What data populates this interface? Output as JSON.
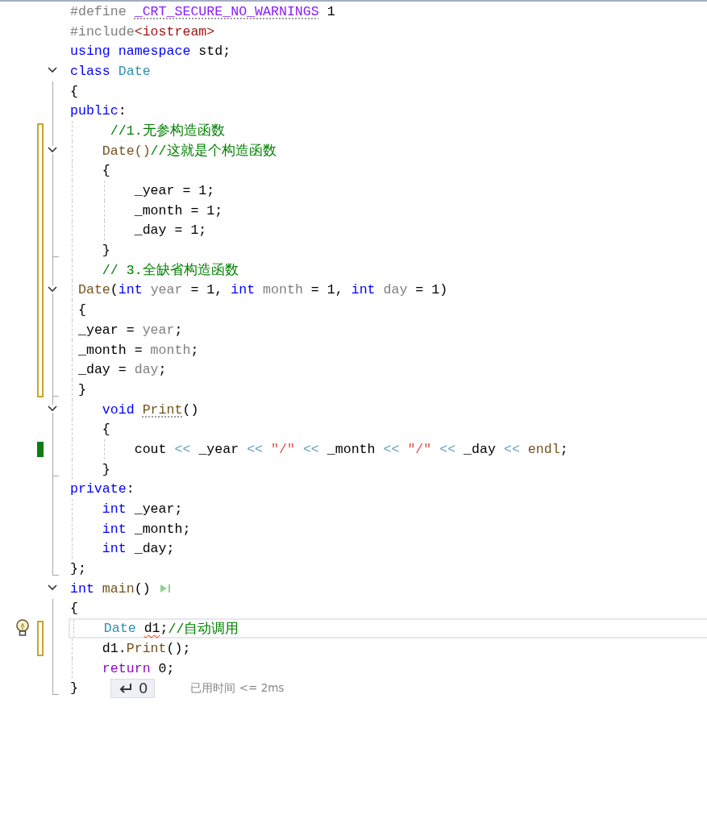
{
  "lines": [
    {
      "tokens": [
        {
          "text": "#define",
          "kind": "preprocessor"
        },
        {
          "text": " _CRT_SECURE_NO_WARNINGS",
          "kind": "macro",
          "hint": true
        },
        {
          "text": " 1",
          "kind": "plain"
        }
      ],
      "modified": false,
      "saved": false,
      "current": false,
      "lightbulb": false
    },
    {
      "tokens": [
        {
          "text": "#include",
          "kind": "preprocessor"
        },
        {
          "text": "<iostream>",
          "kind": "include_path"
        }
      ],
      "modified": false,
      "saved": false,
      "current": false,
      "lightbulb": false
    },
    {
      "tokens": [
        {
          "text": "using namespace",
          "kind": "keyword"
        },
        {
          "text": " std;",
          "kind": "plain"
        }
      ],
      "modified": false,
      "saved": false,
      "current": false,
      "lightbulb": false
    },
    {
      "tokens": [
        {
          "text": "class",
          "kind": "keyword"
        },
        {
          "text": " Date",
          "kind": "type"
        }
      ],
      "modified": false,
      "saved": false,
      "current": false,
      "lightbulb": false,
      "expanded": true,
      "children": [
        {
          "tokens": [
            {
              "text": "{",
              "kind": "plain"
            }
          ],
          "modified": false,
          "saved": false,
          "current": false,
          "lightbulb": false
        },
        {
          "tokens": [
            {
              "text": "public",
              "kind": "keyword"
            },
            {
              "text": ":",
              "kind": "plain"
            }
          ],
          "modified": false,
          "saved": false,
          "current": false,
          "lightbulb": false
        },
        {
          "tokens": [
            {
              "text": "     //1.无参构造函数",
              "kind": "comment"
            }
          ],
          "modified": true,
          "saved": false,
          "current": false,
          "lightbulb": false
        },
        {
          "tokens": [
            {
              "text": "    Date()",
              "kind": "function"
            },
            {
              "text": "//这就是个构造函数",
              "kind": "comment"
            }
          ],
          "modified": true,
          "saved": false,
          "current": false,
          "lightbulb": false,
          "expanded": true,
          "children": [
            {
              "tokens": [
                {
                  "text": "    {",
                  "kind": "plain"
                }
              ],
              "modified": true,
              "saved": false,
              "current": false,
              "lightbulb": false
            },
            {
              "tokens": [
                {
                  "text": "        _year = 1;",
                  "kind": "plain"
                }
              ],
              "modified": true,
              "saved": false,
              "current": false,
              "lightbulb": false
            },
            {
              "tokens": [
                {
                  "text": "        _month = 1;",
                  "kind": "plain"
                }
              ],
              "modified": true,
              "saved": false,
              "current": false,
              "lightbulb": false
            },
            {
              "tokens": [
                {
                  "text": "        _day = 1;",
                  "kind": "plain"
                }
              ],
              "modified": true,
              "saved": false,
              "current": false,
              "lightbulb": false
            },
            {
              "tokens": [
                {
                  "text": "    }",
                  "kind": "plain"
                }
              ],
              "modified": true,
              "saved": false,
              "current": false,
              "lightbulb": false
            }
          ]
        },
        {
          "tokens": [
            {
              "text": "    // 3.全缺省构造函数",
              "kind": "comment"
            }
          ],
          "modified": true,
          "saved": false,
          "current": false,
          "lightbulb": false
        },
        {
          "tokens": [
            {
              "text": " Date",
              "kind": "function"
            },
            {
              "text": "(",
              "kind": "plain"
            },
            {
              "text": "int",
              "kind": "keyword"
            },
            {
              "text": " year",
              "kind": "parameter"
            },
            {
              "text": " = 1,",
              "kind": "plain"
            },
            {
              "text": " int",
              "kind": "keyword"
            },
            {
              "text": " month",
              "kind": "parameter"
            },
            {
              "text": " = 1,",
              "kind": "plain"
            },
            {
              "text": " int",
              "kind": "keyword"
            },
            {
              "text": " day",
              "kind": "parameter"
            },
            {
              "text": " = 1)",
              "kind": "plain"
            }
          ],
          "modified": true,
          "saved": false,
          "current": false,
          "lightbulb": false,
          "expanded": true,
          "children": [
            {
              "tokens": [
                {
                  "text": " {",
                  "kind": "plain"
                }
              ],
              "modified": true,
              "saved": false,
              "current": false,
              "lightbulb": false
            },
            {
              "tokens": [
                {
                  "text": " _year = ",
                  "kind": "plain"
                },
                {
                  "text": "year",
                  "kind": "parameter"
                },
                {
                  "text": ";",
                  "kind": "plain"
                }
              ],
              "modified": true,
              "saved": false,
              "current": false,
              "lightbulb": false
            },
            {
              "tokens": [
                {
                  "text": " _month = ",
                  "kind": "plain"
                },
                {
                  "text": "month",
                  "kind": "parameter"
                },
                {
                  "text": ";",
                  "kind": "plain"
                }
              ],
              "modified": true,
              "saved": false,
              "current": false,
              "lightbulb": false
            },
            {
              "tokens": [
                {
                  "text": " _day = ",
                  "kind": "plain"
                },
                {
                  "text": "day",
                  "kind": "parameter"
                },
                {
                  "text": ";",
                  "kind": "plain"
                }
              ],
              "modified": true,
              "saved": false,
              "current": false,
              "lightbulb": false
            },
            {
              "tokens": [
                {
                  "text": " }",
                  "kind": "plain"
                }
              ],
              "modified": true,
              "saved": false,
              "current": false,
              "lightbulb": false
            }
          ]
        },
        {
          "tokens": [
            {
              "text": "    void",
              "kind": "keyword"
            },
            {
              "text": " Print",
              "kind": "function",
              "hint": true
            },
            {
              "text": "()",
              "kind": "plain"
            }
          ],
          "modified": false,
          "saved": false,
          "current": false,
          "lightbulb": false,
          "expanded": true,
          "children": [
            {
              "tokens": [
                {
                  "text": "    {",
                  "kind": "plain"
                }
              ],
              "modified": false,
              "saved": false,
              "current": false,
              "lightbulb": false
            },
            {
              "tokens": [
                {
                  "text": "        cout",
                  "kind": "plain"
                },
                {
                  "text": " <<",
                  "kind": "operator"
                },
                {
                  "text": " _year",
                  "kind": "plain"
                },
                {
                  "text": " <<",
                  "kind": "operator"
                },
                {
                  "text": " \"/\"",
                  "kind": "string"
                },
                {
                  "text": " <<",
                  "kind": "operator"
                },
                {
                  "text": " _month",
                  "kind": "plain"
                },
                {
                  "text": " <<",
                  "kind": "operator"
                },
                {
                  "text": " \"/\"",
                  "kind": "string"
                },
                {
                  "text": " <<",
                  "kind": "operator"
                },
                {
                  "text": " _day",
                  "kind": "plain"
                },
                {
                  "text": " <<",
                  "kind": "operator"
                },
                {
                  "text": " endl",
                  "kind": "function"
                },
                {
                  "text": ";",
                  "kind": "plain"
                }
              ],
              "modified": false,
              "saved": true,
              "current": false,
              "lightbulb": false
            },
            {
              "tokens": [
                {
                  "text": "    }",
                  "kind": "plain"
                }
              ],
              "modified": false,
              "saved": false,
              "current": false,
              "lightbulb": false
            }
          ]
        },
        {
          "tokens": [
            {
              "text": "private",
              "kind": "keyword"
            },
            {
              "text": ":",
              "kind": "plain"
            }
          ],
          "modified": false,
          "saved": false,
          "current": false,
          "lightbulb": false
        },
        {
          "tokens": [
            {
              "text": "    int",
              "kind": "keyword"
            },
            {
              "text": " _year;",
              "kind": "plain"
            }
          ],
          "modified": false,
          "saved": false,
          "current": false,
          "lightbulb": false
        },
        {
          "tokens": [
            {
              "text": "    int",
              "kind": "keyword"
            },
            {
              "text": " _month;",
              "kind": "plain"
            }
          ],
          "modified": false,
          "saved": false,
          "current": false,
          "lightbulb": false
        },
        {
          "tokens": [
            {
              "text": "    int",
              "kind": "keyword"
            },
            {
              "text": " _day;",
              "kind": "plain"
            }
          ],
          "modified": false,
          "saved": false,
          "current": false,
          "lightbulb": false
        },
        {
          "tokens": [
            {
              "text": "};",
              "kind": "plain"
            }
          ],
          "modified": false,
          "saved": false,
          "current": false,
          "lightbulb": false
        }
      ]
    },
    {
      "tokens": [
        {
          "text": "int",
          "kind": "keyword"
        },
        {
          "text": " main",
          "kind": "function"
        },
        {
          "text": "()",
          "kind": "plain"
        }
      ],
      "modified": false,
      "saved": false,
      "current": false,
      "lightbulb": false,
      "run_button": true,
      "expanded": true,
      "children": [
        {
          "tokens": [
            {
              "text": "{",
              "kind": "plain"
            }
          ],
          "modified": false,
          "saved": false,
          "current": false,
          "lightbulb": false
        },
        {
          "tokens": [
            {
              "text": "    Date",
              "kind": "type"
            },
            {
              "text": " d1",
              "kind": "plain",
              "error": true
            },
            {
              "text": ";",
              "kind": "plain"
            },
            {
              "text": "//自动调用",
              "kind": "comment"
            }
          ],
          "modified": true,
          "saved": false,
          "current": true,
          "lightbulb": true
        },
        {
          "tokens": [
            {
              "text": "    d1.",
              "kind": "plain"
            },
            {
              "text": "Print",
              "kind": "function"
            },
            {
              "text": "();",
              "kind": "plain"
            }
          ],
          "modified": true,
          "saved": false,
          "current": false,
          "lightbulb": false
        },
        {
          "tokens": [
            {
              "text": "    return",
              "kind": "control"
            },
            {
              "text": " 0;",
              "kind": "plain"
            }
          ],
          "modified": false,
          "saved": false,
          "current": false,
          "lightbulb": false
        },
        {
          "tokens": [
            {
              "text": "}",
              "kind": "plain"
            }
          ],
          "modified": false,
          "saved": false,
          "current": false,
          "lightbulb": false,
          "result": {
            "value": "0",
            "elapsed": "已用时间 <= 2ms"
          }
        }
      ]
    }
  ]
}
